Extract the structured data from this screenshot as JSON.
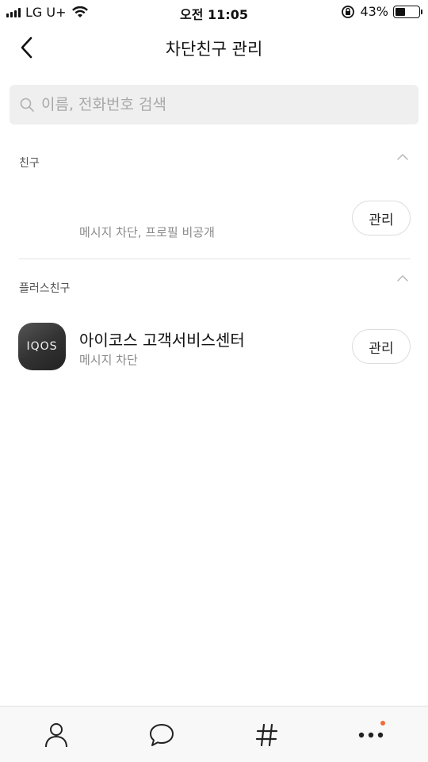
{
  "status_bar": {
    "carrier": "LG U+",
    "time": "오전 11:05",
    "battery_percent": "43%",
    "battery_level": 0.43
  },
  "header": {
    "title": "차단친구 관리"
  },
  "search": {
    "placeholder": "이름, 전화번호 검색",
    "value": ""
  },
  "sections": {
    "friends": {
      "title": "친구",
      "items": [
        {
          "name": "",
          "status": "메시지 차단, 프로필 비공개",
          "button": "관리"
        }
      ]
    },
    "plus_friends": {
      "title": "플러스친구",
      "items": [
        {
          "name": "아이코스 고객서비스센터",
          "status": "메시지 차단",
          "button": "관리",
          "avatar_text": "IQOS"
        }
      ]
    }
  },
  "tab_bar": {
    "tabs": [
      "person-icon",
      "chat-bubble-icon",
      "hashtag-icon",
      "more-icon"
    ],
    "notification_color": "#f16b3a"
  }
}
